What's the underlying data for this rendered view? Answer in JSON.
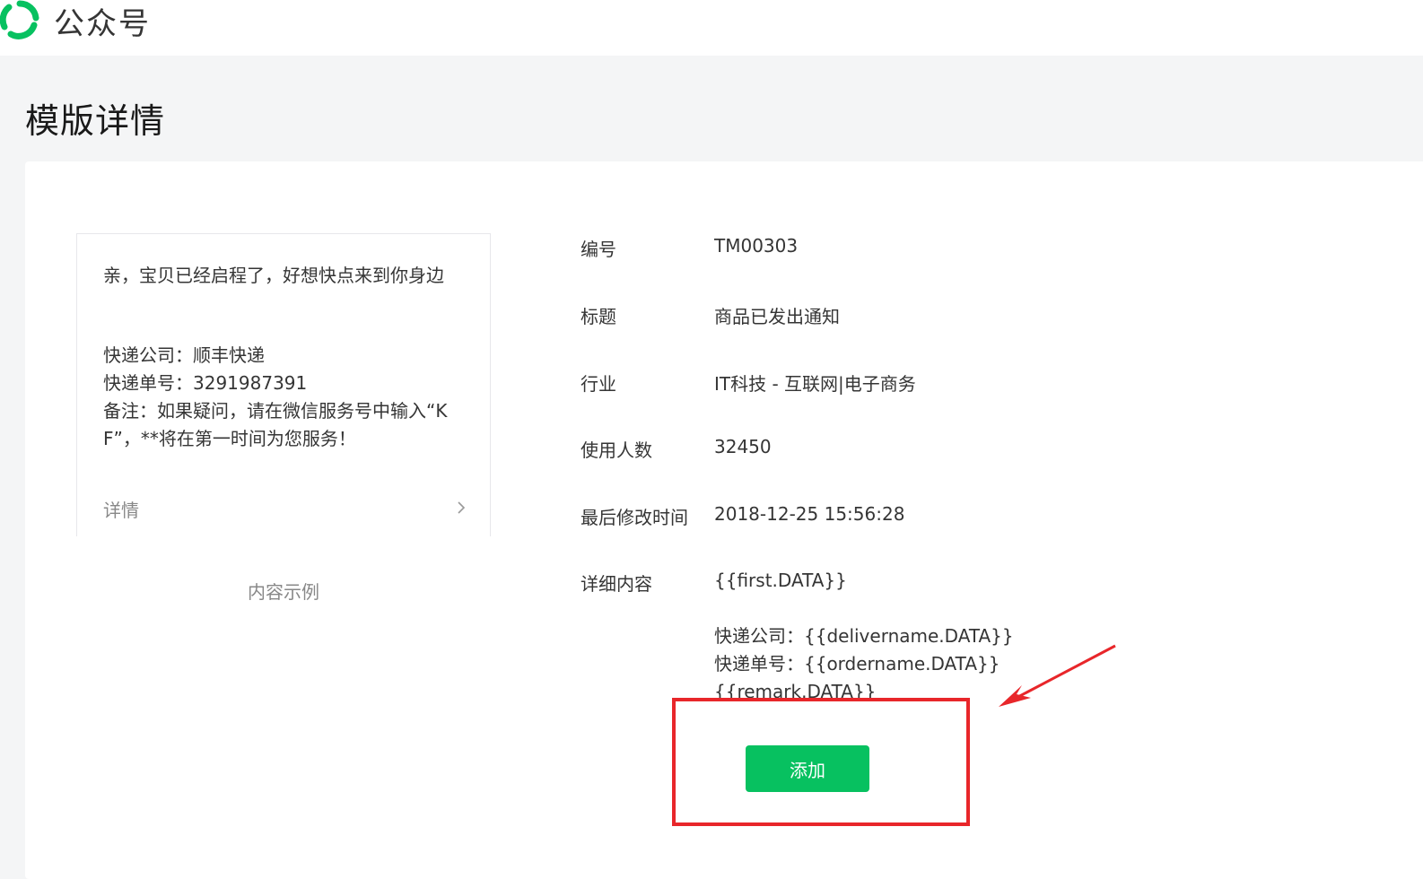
{
  "header": {
    "brand": "公众号"
  },
  "page": {
    "title": "模版详情"
  },
  "preview": {
    "title": "亲，宝贝已经启程了，好想快点来到你身边",
    "lines": [
      "快递公司：顺丰快递",
      "快递单号：3291987391",
      "备注：如果疑问，请在微信服务号中输入“KF”，**将在第一时间为您服务！"
    ],
    "detail_label": "详情",
    "caption": "内容示例"
  },
  "info": {
    "id_label": "编号",
    "id_value": "TM00303",
    "title_label": "标题",
    "title_value": "商品已发出通知",
    "industry_label": "行业",
    "industry_value": "IT科技 - 互联网|电子商务",
    "users_label": "使用人数",
    "users_value": "32450",
    "modified_label": "最后修改时间",
    "modified_value": "2018-12-25 15:56:28",
    "content_label": "详细内容",
    "content_first": "{{first.DATA}}",
    "content_lines": [
      "快递公司：{{delivername.DATA}}",
      "快递单号：{{ordername.DATA}}",
      "{{remark.DATA}}"
    ]
  },
  "actions": {
    "add_label": "添加"
  },
  "colors": {
    "accent": "#07c160",
    "annotation": "#e8262a"
  },
  "icons": {
    "logo": "wechat-official-account-logo-icon",
    "chevron": "chevron-right-icon"
  }
}
